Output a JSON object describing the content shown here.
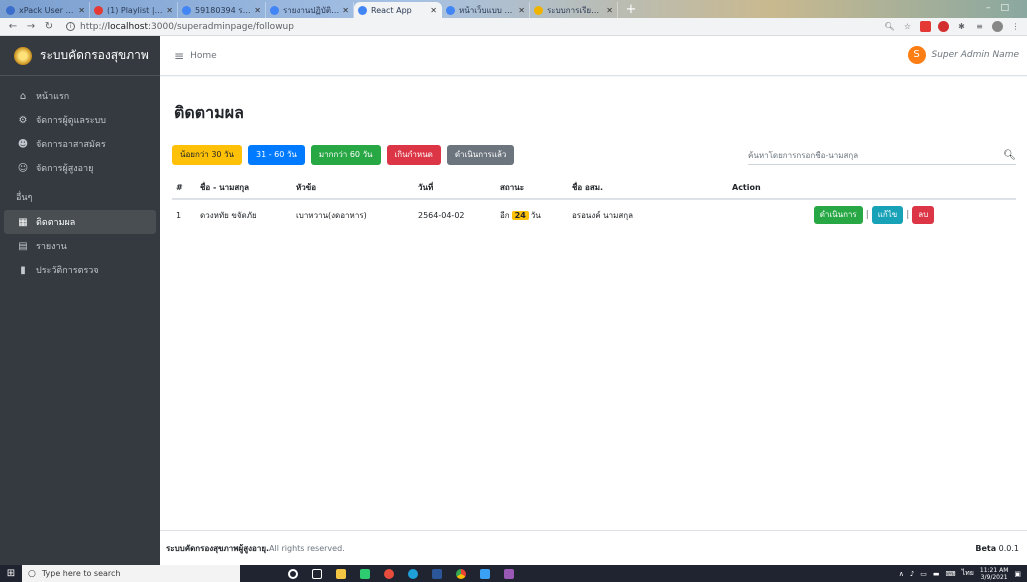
{
  "browser": {
    "tabs": [
      {
        "title": "xPack User Profile",
        "color": "#3b6ecc"
      },
      {
        "title": "(1) Playlist | Siwa...",
        "color": "#e53935"
      },
      {
        "title": "59180394 รายงานการ...",
        "color": "#4285f4"
      },
      {
        "title": "รายงานปฏิบัติงานสหกิจ...",
        "color": "#4285f4"
      },
      {
        "title": "React App",
        "color": "#4285f4",
        "active": true
      },
      {
        "title": "หน้าเว็บแบบ respo - Go...",
        "color": "#4285f4"
      },
      {
        "title": "ระบบการเรียนออนไลน์",
        "color": "#f0b400"
      }
    ],
    "url_prefix": "http://",
    "url_host": "localhost",
    "url_path": ":3000/superadminpage/followup"
  },
  "sidebar": {
    "brand": "ระบบคัดกรองสุขภาพ",
    "items": [
      {
        "icon": "home-icon",
        "glyph": "⌂",
        "label": "หน้าแรก"
      },
      {
        "icon": "users-cog-icon",
        "glyph": "⚙",
        "label": "จัดการผู้ดูแลระบบ"
      },
      {
        "icon": "volunteer-icon",
        "glyph": "☻",
        "label": "จัดการอาสาสมัคร"
      },
      {
        "icon": "elderly-icon",
        "glyph": "☺",
        "label": "จัดการผู้สูงอายุ"
      }
    ],
    "section_header": "อื่นๆ",
    "items2": [
      {
        "icon": "calendar-icon",
        "glyph": "▦",
        "label": "ติดตามผล",
        "active": true
      },
      {
        "icon": "report-icon",
        "glyph": "▤",
        "label": "รายงาน"
      },
      {
        "icon": "history-icon",
        "glyph": "▮",
        "label": "ประวัติการตรวจ"
      }
    ]
  },
  "topnav": {
    "home": "Home",
    "avatar_letter": "S",
    "user_name": "Super Admin Name"
  },
  "page": {
    "title": "ติดตามผล",
    "filters": [
      {
        "label": "น้อยกว่า 30 วัน",
        "color": "yellow"
      },
      {
        "label": "31 - 60 วัน",
        "color": "blue"
      },
      {
        "label": "มากกว่า 60 วัน",
        "color": "green"
      },
      {
        "label": "เกินกำหนด",
        "color": "red"
      },
      {
        "label": "ดำเนินการแล้ว",
        "color": "gray"
      }
    ],
    "search_placeholder": "ค้นหาโดยการกรอกชื่อ-นามสกุล"
  },
  "table": {
    "headers": {
      "idx": "#",
      "name": "ชื่อ - นามสกุล",
      "topic": "หัวข้อ",
      "date": "วันที่",
      "status": "สถานะ",
      "osm": "ชื่อ อสม.",
      "action": "Action"
    },
    "rows": [
      {
        "idx": "1",
        "name": "ดวงหทัย ขจัดภัย",
        "topic": "เบาหวาน(งดอาหาร)",
        "date": "2564-04-02",
        "status_prefix": "อีก",
        "status_days": "24",
        "status_suffix": "วัน",
        "osm": "อรอนงค์ นามสกุล",
        "actions": {
          "process": "ดำเนินการ",
          "edit": "แก้ไข",
          "delete": "ลบ",
          "sep": "|"
        }
      }
    ]
  },
  "footer": {
    "brand": "ระบบคัดกรองสุขภาพผู้สูงอายุ.",
    "rest": "All rights reserved.",
    "version_label": "Beta",
    "version_number": "0.0.1"
  },
  "taskbar": {
    "search_placeholder": "Type here to search",
    "time": "11:21 AM",
    "date": "3/9/2021",
    "lang": "ไทย"
  }
}
